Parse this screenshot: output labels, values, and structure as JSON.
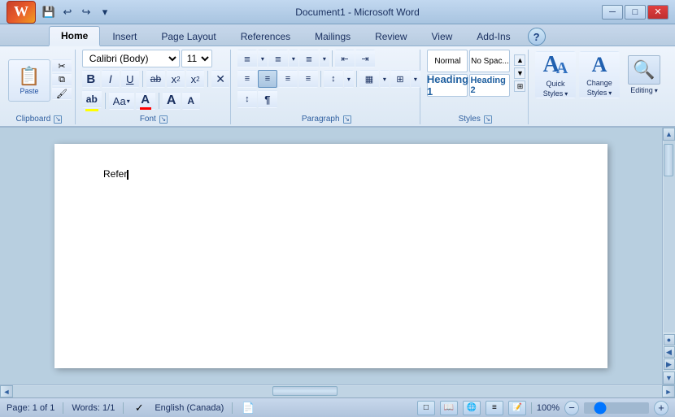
{
  "titlebar": {
    "title": "Document1 - Microsoft Word",
    "quick_access": [
      "save",
      "undo",
      "redo",
      "customize"
    ],
    "window_controls": [
      "minimize",
      "maximize",
      "close"
    ]
  },
  "tabs": {
    "items": [
      "Home",
      "Insert",
      "Page Layout",
      "References",
      "Mailings",
      "Review",
      "View",
      "Add-Ins"
    ],
    "active": "Home"
  },
  "ribbon": {
    "groups": {
      "clipboard": {
        "label": "Clipboard",
        "paste": "Paste"
      },
      "font": {
        "label": "Font",
        "font_name": "Calibri (Body)",
        "font_size": "11",
        "bold": "B",
        "italic": "I",
        "underline": "U",
        "strikethrough": "ab",
        "subscript": "x",
        "superscript": "x",
        "clear_formatting": "🧹",
        "highlight": "ab",
        "font_color": "A",
        "grow": "A",
        "shrink": "A"
      },
      "paragraph": {
        "label": "Paragraph"
      },
      "styles": {
        "label": "Styles",
        "quick_styles": "Quick\nStyles",
        "change_styles": "Change\nStyles"
      },
      "editing": {
        "label": "",
        "editing": "Editing"
      }
    }
  },
  "document": {
    "content": "Refer",
    "cursor_visible": true
  },
  "statusbar": {
    "page": "Page: 1 of 1",
    "words": "Words: 1/1",
    "language": "English (Canada)",
    "zoom": "100%",
    "zoom_value": 100
  },
  "icons": {
    "save": "💾",
    "undo": "↩",
    "redo": "↪",
    "customize": "▾",
    "minimize": "─",
    "maximize": "□",
    "close": "✕",
    "scroll_up": "▲",
    "scroll_down": "▼",
    "scroll_left": "◄",
    "scroll_right": "►",
    "paste_icon": "📋",
    "cut": "✂",
    "copy": "⧉",
    "format_painter": "🖌",
    "bold": "B",
    "italic": "I",
    "underline": "U",
    "help": "?"
  }
}
